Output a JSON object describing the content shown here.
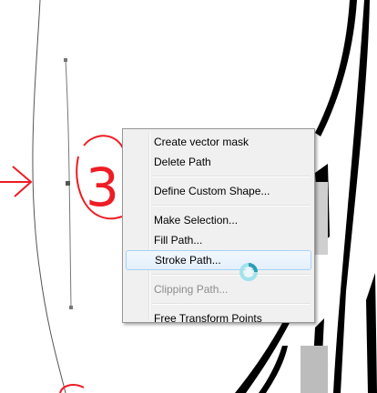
{
  "context_menu": {
    "items": [
      {
        "label": "Create vector mask",
        "enabled": true
      },
      {
        "label": "Delete Path",
        "enabled": true
      },
      {
        "label": "Define Custom Shape...",
        "enabled": true
      },
      {
        "label": "Make Selection...",
        "enabled": true
      },
      {
        "label": "Fill Path...",
        "enabled": true
      },
      {
        "label": "Stroke Path...",
        "enabled": true,
        "highlighted": true
      },
      {
        "label": "Clipping Path...",
        "enabled": false
      },
      {
        "label": "Free Transform Points",
        "enabled": true
      }
    ]
  },
  "annotation": {
    "number": "3",
    "color": "#ee1c24"
  },
  "cursor": {
    "icon": "busy-spinner-icon"
  },
  "colors": {
    "menu_background": "#f0f0f0",
    "highlight_border": "#a8d1f6",
    "annotation_red": "#ee1c24",
    "path_gray": "#777777"
  }
}
